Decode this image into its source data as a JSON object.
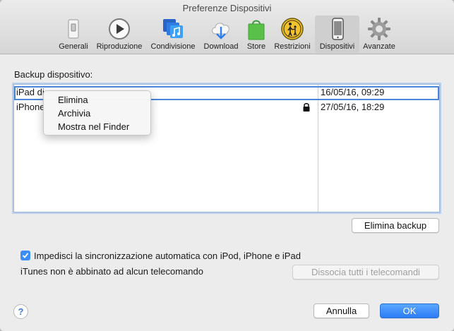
{
  "window": {
    "title": "Preferenze Dispositivi"
  },
  "toolbar": {
    "items": [
      {
        "label": "Generali",
        "icon": "switch-icon"
      },
      {
        "label": "Riproduzione",
        "icon": "play-icon"
      },
      {
        "label": "Condivisione",
        "icon": "music-share-icon"
      },
      {
        "label": "Download",
        "icon": "cloud-download-icon"
      },
      {
        "label": "Store",
        "icon": "shopping-bag-icon"
      },
      {
        "label": "Restrizioni",
        "icon": "parental-restrictions-icon"
      },
      {
        "label": "Dispositivi",
        "icon": "iphone-icon",
        "selected": true
      },
      {
        "label": "Avanzate",
        "icon": "gear-icon"
      }
    ]
  },
  "backup": {
    "section_label": "Backup dispositivo:",
    "rows": [
      {
        "name": "iPad di",
        "date": "16/05/16, 09:29",
        "locked": false
      },
      {
        "name": "iPhone",
        "date": "27/05/16, 18:29",
        "locked": true
      }
    ],
    "delete_button": "Elimina backup"
  },
  "context_menu": {
    "items": [
      "Elimina",
      "Archivia",
      "Mostra nel Finder"
    ]
  },
  "sync": {
    "checkbox_label": "Impedisci la sincronizzazione automatica con iPod, iPhone e iPad",
    "checked": true
  },
  "remote": {
    "status_text": "iTunes non è abbinato ad alcun telecomando",
    "unpair_button": "Dissocia tutti i telecomandi"
  },
  "footer": {
    "help": "?",
    "cancel": "Annulla",
    "ok": "OK"
  },
  "colors": {
    "accent": "#2c7cf6",
    "selection_border": "#4a86d8"
  }
}
